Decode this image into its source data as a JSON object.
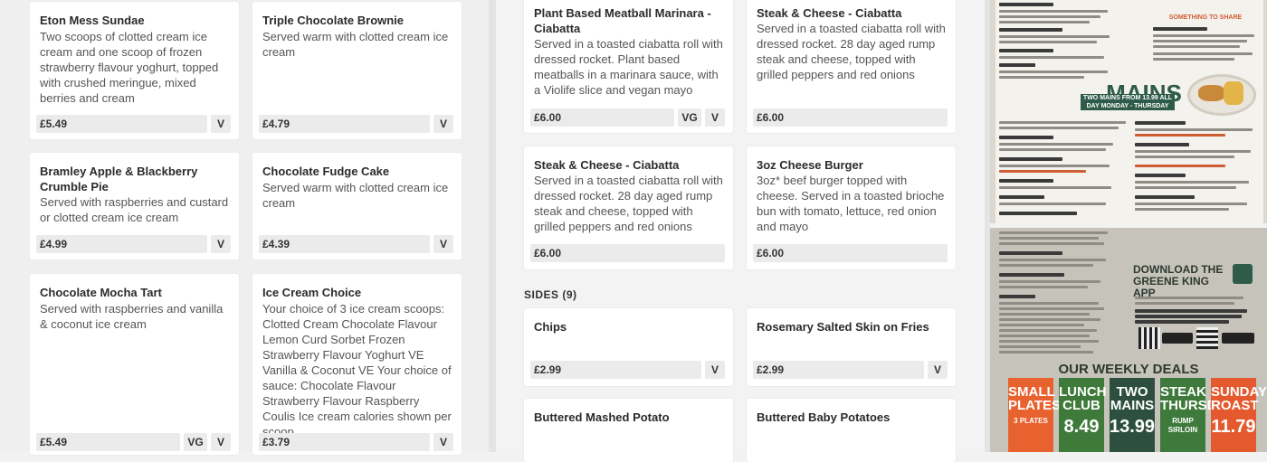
{
  "desserts": [
    {
      "name": "Eton Mess Sundae",
      "desc": "Two scoops of clotted cream ice cream and one scoop of frozen strawberry flavour yoghurt, topped with crushed meringue, mixed berries and cream",
      "price": "£5.49",
      "tags": [
        "V"
      ]
    },
    {
      "name": "Triple Chocolate Brownie",
      "desc": "Served warm with clotted cream ice cream",
      "price": "£4.79",
      "tags": [
        "V"
      ]
    },
    {
      "name": "Bramley Apple & Blackberry Crumble Pie",
      "desc": "Served with raspberries and custard or clotted cream ice cream",
      "price": "£4.99",
      "tags": [
        "V"
      ]
    },
    {
      "name": "Chocolate Fudge Cake",
      "desc": "Served warm with clotted cream ice cream",
      "price": "£4.39",
      "tags": [
        "V"
      ]
    },
    {
      "name": "Chocolate Mocha Tart",
      "desc": "Served with raspberries and vanilla & coconut ice cream",
      "price": "£5.49",
      "tags": [
        "VG",
        "V"
      ]
    },
    {
      "name": "Ice Cream Choice",
      "desc": "Your choice of 3 ice cream scoops: Clotted Cream Chocolate Flavour Lemon Curd Sorbet Frozen Strawberry Flavour Yoghurt VE Vanilla & Coconut VE Your choice of sauce: Chocolate Flavour Strawberry Flavour Raspberry Coulis Ice cream calories shown per scoop",
      "price": "£3.79",
      "tags": [
        "V"
      ]
    }
  ],
  "mains": [
    {
      "name": "Plant Based Meatball Marinara - Ciabatta",
      "desc": "Served in a toasted ciabatta roll with dressed rocket. Plant based meatballs in a marinara sauce, with a Violife slice and vegan mayo",
      "price": "£6.00",
      "tags": [
        "VG",
        "V"
      ]
    },
    {
      "name": "Steak & Cheese - Ciabatta",
      "desc": "Served in a toasted ciabatta roll with dressed rocket. 28 day aged rump steak and cheese, topped with grilled peppers and red onions",
      "price": "£6.00",
      "tags": []
    },
    {
      "name": "Steak & Cheese - Ciabatta",
      "desc": "Served in a toasted ciabatta roll with dressed rocket. 28 day aged rump steak and cheese, topped with grilled peppers and red onions",
      "price": "£6.00",
      "tags": []
    },
    {
      "name": "3oz Cheese Burger",
      "desc": "3oz* beef burger topped with cheese. Served in a toasted brioche bun with tomato, lettuce, red onion and mayo",
      "price": "£6.00",
      "tags": []
    }
  ],
  "sides_heading": "SIDES (9)",
  "sides": [
    {
      "name": "Chips",
      "price": "£2.99",
      "tags": [
        "V"
      ]
    },
    {
      "name": "Rosemary Salted Skin on Fries",
      "price": "£2.99",
      "tags": [
        "V"
      ]
    },
    {
      "name": "Buttered Mashed Potato"
    },
    {
      "name": "Buttered Baby Potatoes"
    }
  ],
  "photo_top": {
    "mains_heading": "MAINS",
    "mains_banner": "TWO MAINS FROM 13.99 ALL DAY MONDAY - THURSDAY",
    "share_heading": "SOMETHING TO SHARE"
  },
  "photo_bottom": {
    "app_heading": "DOWNLOAD THE GREENE KING APP",
    "deals_heading": "OUR WEEKLY DEALS",
    "deals": [
      {
        "title": "SMALL PLATES",
        "sub": "3 PLATES",
        "big": "",
        "color": "#e8622f"
      },
      {
        "title": "LUNCH CLUB",
        "sub": "",
        "big": "8.49",
        "color": "#3e7b3a"
      },
      {
        "title": "TWO MAINS",
        "sub": "",
        "big": "13.99",
        "color": "#2c4f3f"
      },
      {
        "title": "STEAK THURSDAY",
        "sub": "RUMP SIRLOIN",
        "big": "",
        "color": "#3d7a3b"
      },
      {
        "title": "SUNDAY ROAST",
        "sub": "",
        "big": "11.79",
        "color": "#e45a2e"
      }
    ]
  },
  "colors": {
    "accent_orange": "#e8622f",
    "brand_green": "#2e5b4a"
  }
}
